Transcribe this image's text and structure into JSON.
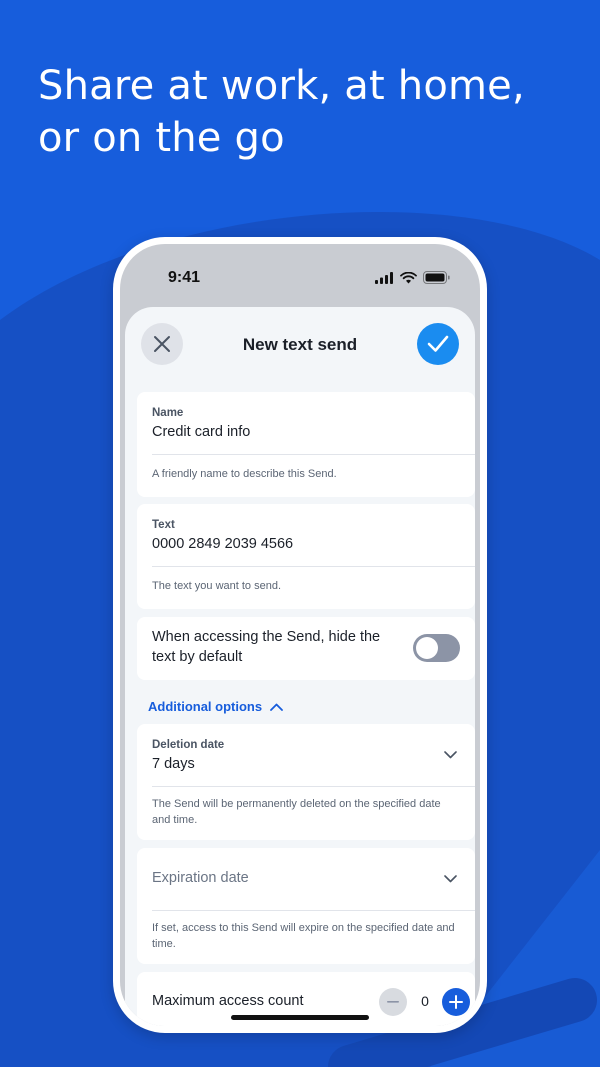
{
  "headline": "Share at work, at home, or on the go",
  "colors": {
    "background": "#175DDC",
    "accent": "#1a8cf0",
    "link": "#175DDC",
    "toggle_off": "#8c94a6"
  },
  "status_bar": {
    "time": "9:41",
    "icons": [
      "cellular-signal-icon",
      "wifi-icon",
      "battery-icon"
    ]
  },
  "sheet": {
    "title": "New text send",
    "close_icon": "close-icon",
    "confirm_icon": "checkmark-icon"
  },
  "form": {
    "name": {
      "label": "Name",
      "value": "Credit card info",
      "help": "A friendly name to describe this Send."
    },
    "text": {
      "label": "Text",
      "value": "0000 2849 2039 4566",
      "help": "The text you want to send."
    },
    "hide_text": {
      "label": "When accessing the Send, hide the text by default",
      "enabled": false
    },
    "additional_options": {
      "label": "Additional options",
      "expanded": true
    },
    "deletion_date": {
      "label": "Deletion date",
      "value": "7 days",
      "help": "The Send will be permanently deleted on the specified date and time."
    },
    "expiration_date": {
      "placeholder": "Expiration date",
      "help": "If set, access to this Send will expire on the specified date and time."
    },
    "max_access_count": {
      "label": "Maximum access count",
      "value": "0"
    }
  }
}
